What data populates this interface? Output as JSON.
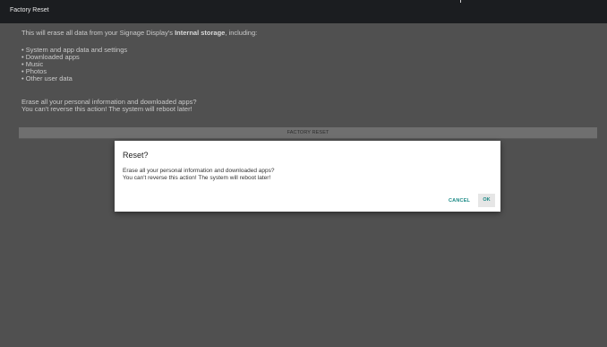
{
  "app": {
    "title": "Factory Reset"
  },
  "settings": {
    "intro_prefix": "This will erase all data from your Signage Display's ",
    "intro_bold": "Internal storage",
    "intro_suffix": ", including:",
    "items": [
      "System and app data and settings",
      "Downloaded apps",
      "Music",
      "Photos",
      "Other user data"
    ],
    "warning_line1": "Erase all your personal information and downloaded apps?",
    "warning_line2": "You can't reverse this action! The system will reboot later!",
    "reset_button_label": "FACTORY RESET"
  },
  "dialog": {
    "title": "Reset?",
    "message_line1": "Erase all your personal information and downloaded apps?",
    "message_line2": "You can't reverse this action! The system will reboot later!",
    "cancel_label": "CANCEL",
    "ok_label": "OK"
  },
  "colors": {
    "accent": "#1b8a86",
    "scrim_background": "#505050",
    "topbar": "#1b1d20"
  }
}
